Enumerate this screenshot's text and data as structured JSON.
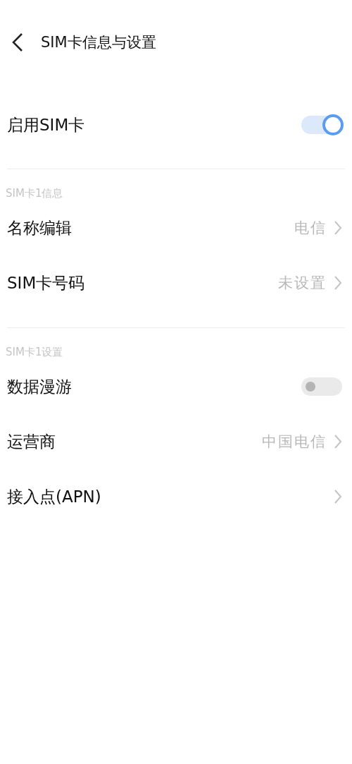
{
  "header": {
    "title": "SIM卡信息与设置"
  },
  "main_switch": {
    "label": "启用SIM卡",
    "on": true
  },
  "sections": [
    {
      "title": "SIM卡1信息",
      "items": [
        {
          "kind": "link",
          "label": "名称编辑",
          "value": "电信"
        },
        {
          "kind": "link",
          "label": "SIM卡号码",
          "value": "未设置"
        }
      ]
    },
    {
      "title": "SIM卡1设置",
      "items": [
        {
          "kind": "switch",
          "label": "数据漫游",
          "on": false
        },
        {
          "kind": "link",
          "label": "运营商",
          "value": "中国电信"
        },
        {
          "kind": "link",
          "label": "接入点(APN)"
        }
      ]
    }
  ]
}
